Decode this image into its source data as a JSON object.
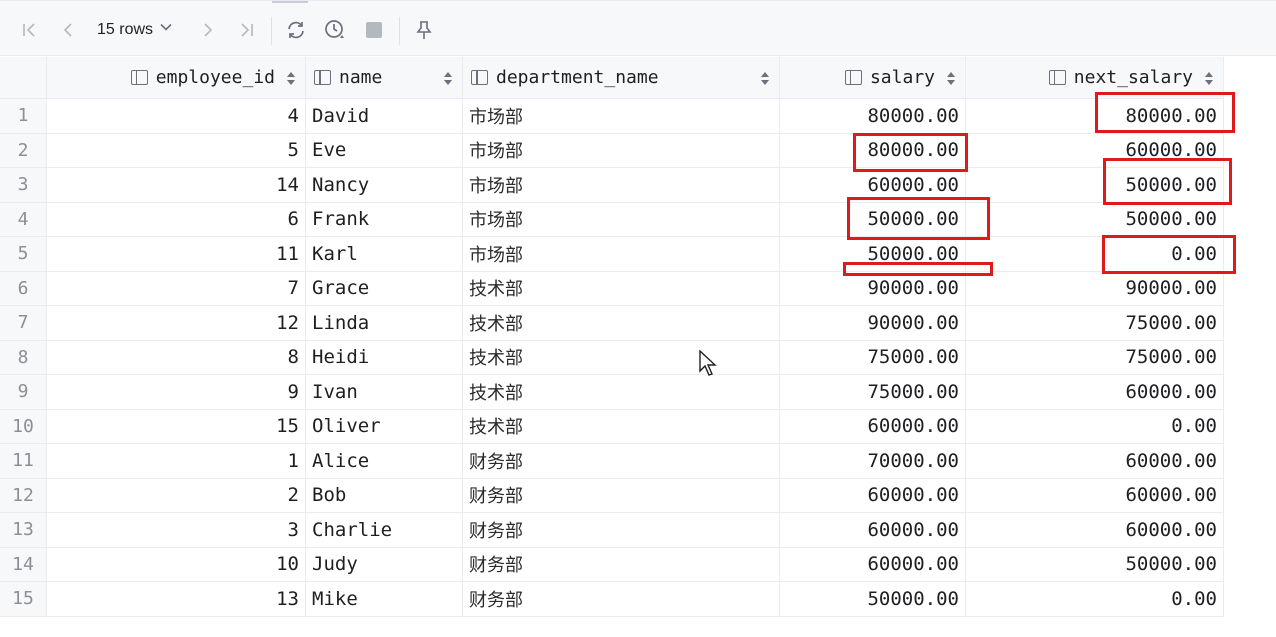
{
  "toolbar": {
    "rows_label": "15 rows",
    "icons": [
      "first-page-icon",
      "prev-page-icon",
      "chevron-down-icon",
      "next-page-icon",
      "last-page-icon",
      "refresh-icon",
      "history-icon",
      "stop-icon",
      "pin-icon"
    ]
  },
  "columns": [
    {
      "label": "employee_id"
    },
    {
      "label": "name"
    },
    {
      "label": "department_name"
    },
    {
      "label": "salary"
    },
    {
      "label": "next_salary"
    }
  ],
  "rows": [
    {
      "n": "1",
      "employee_id": "4",
      "name": "David",
      "department_name": "市场部",
      "salary": "80000.00",
      "next_salary": "80000.00"
    },
    {
      "n": "2",
      "employee_id": "5",
      "name": "Eve",
      "department_name": "市场部",
      "salary": "80000.00",
      "next_salary": "60000.00"
    },
    {
      "n": "3",
      "employee_id": "14",
      "name": "Nancy",
      "department_name": "市场部",
      "salary": "60000.00",
      "next_salary": "50000.00"
    },
    {
      "n": "4",
      "employee_id": "6",
      "name": "Frank",
      "department_name": "市场部",
      "salary": "50000.00",
      "next_salary": "50000.00"
    },
    {
      "n": "5",
      "employee_id": "11",
      "name": "Karl",
      "department_name": "市场部",
      "salary": "50000.00",
      "next_salary": "0.00"
    },
    {
      "n": "6",
      "employee_id": "7",
      "name": "Grace",
      "department_name": "技术部",
      "salary": "90000.00",
      "next_salary": "90000.00"
    },
    {
      "n": "7",
      "employee_id": "12",
      "name": "Linda",
      "department_name": "技术部",
      "salary": "90000.00",
      "next_salary": "75000.00"
    },
    {
      "n": "8",
      "employee_id": "8",
      "name": "Heidi",
      "department_name": "技术部",
      "salary": "75000.00",
      "next_salary": "75000.00"
    },
    {
      "n": "9",
      "employee_id": "9",
      "name": "Ivan",
      "department_name": "技术部",
      "salary": "75000.00",
      "next_salary": "60000.00"
    },
    {
      "n": "10",
      "employee_id": "15",
      "name": "Oliver",
      "department_name": "技术部",
      "salary": "60000.00",
      "next_salary": "0.00"
    },
    {
      "n": "11",
      "employee_id": "1",
      "name": "Alice",
      "department_name": "财务部",
      "salary": "70000.00",
      "next_salary": "60000.00"
    },
    {
      "n": "12",
      "employee_id": "2",
      "name": "Bob",
      "department_name": "财务部",
      "salary": "60000.00",
      "next_salary": "60000.00"
    },
    {
      "n": "13",
      "employee_id": "3",
      "name": "Charlie",
      "department_name": "财务部",
      "salary": "60000.00",
      "next_salary": "60000.00"
    },
    {
      "n": "14",
      "employee_id": "10",
      "name": "Judy",
      "department_name": "财务部",
      "salary": "60000.00",
      "next_salary": "50000.00"
    },
    {
      "n": "15",
      "employee_id": "13",
      "name": "Mike",
      "department_name": "财务部",
      "salary": "50000.00",
      "next_salary": "0.00"
    }
  ],
  "colors": {
    "highlight": "#e01a1a",
    "header_bg": "#f7f8fa",
    "grid_line": "#ebecf0"
  }
}
